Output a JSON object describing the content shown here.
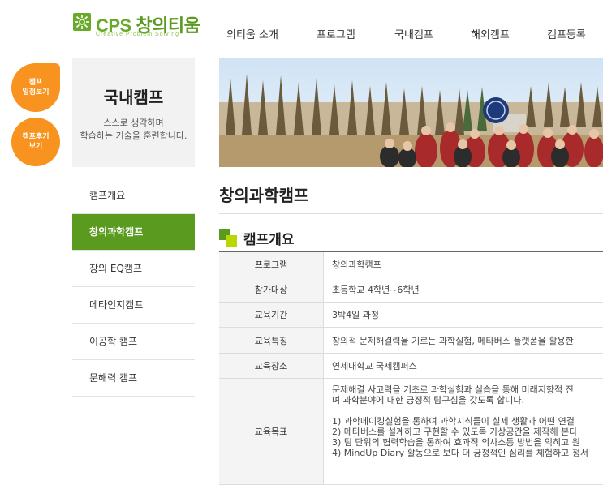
{
  "header": {
    "logo_text_en": "CPS",
    "logo_text_ko": "창의티움",
    "logo_sub": "Creative Problem Solving",
    "nav": [
      "의티움 소개",
      "프로그램",
      "국내캠프",
      "해외캠프",
      "캠프등록"
    ]
  },
  "quick": {
    "schedule": "캠프\n일정보기",
    "review": "캠프후기\n보기"
  },
  "sidebar": {
    "title": "국내캠프",
    "desc_line1": "스스로 생각하며",
    "desc_line2": "학습하는 기술을 훈련합니다.",
    "items": [
      {
        "label": "캠프개요",
        "active": false
      },
      {
        "label": "창의과학캠프",
        "active": true
      },
      {
        "label": "창의 EQ캠프",
        "active": false
      },
      {
        "label": "메타인지캠프",
        "active": false
      },
      {
        "label": "이공학 캠프",
        "active": false
      },
      {
        "label": "문해력 캠프",
        "active": false
      }
    ]
  },
  "main": {
    "page_title": "창의과학캠프",
    "section_title": "캠프개요",
    "rows": [
      {
        "th": "프로그램",
        "td": "창의과학캠프"
      },
      {
        "th": "참가대상",
        "td": "초등학교 4학년~6학년"
      },
      {
        "th": "교육기간",
        "td": "3박4일 과정"
      },
      {
        "th": "교육특징",
        "td": "창의적 문제해결력을 기르는 과학실험, 메타버스 플랫폼을 활용한"
      },
      {
        "th": "교육장소",
        "td": "연세대학교 국제캠퍼스"
      }
    ],
    "goal": {
      "th": "교육목표",
      "lines": [
        "문제해결 사고력을 기초로 과학실험과 실습을 통해 미래지향적 진",
        "며 과학분야에 대한 긍정적 탐구심을 갖도록 합니다.",
        "",
        "1) 과학메이킹실험을 통하여 과학지식들이 실제 생활과 어떤 연결",
        "2) 메타버스를 설계하고 구현할 수 있도록 가상공간을 제작해 본다",
        "3) 팀 단위의 협력학습을 통하여 효과적 의사소통 방법을 익히고 원",
        "4) MindUp Diary 활동으로 보다 더 긍정적인 심리를 체험하고 정서"
      ]
    }
  },
  "colors": {
    "brand_green": "#5a9a1e",
    "quick_orange": "#f7931e"
  }
}
